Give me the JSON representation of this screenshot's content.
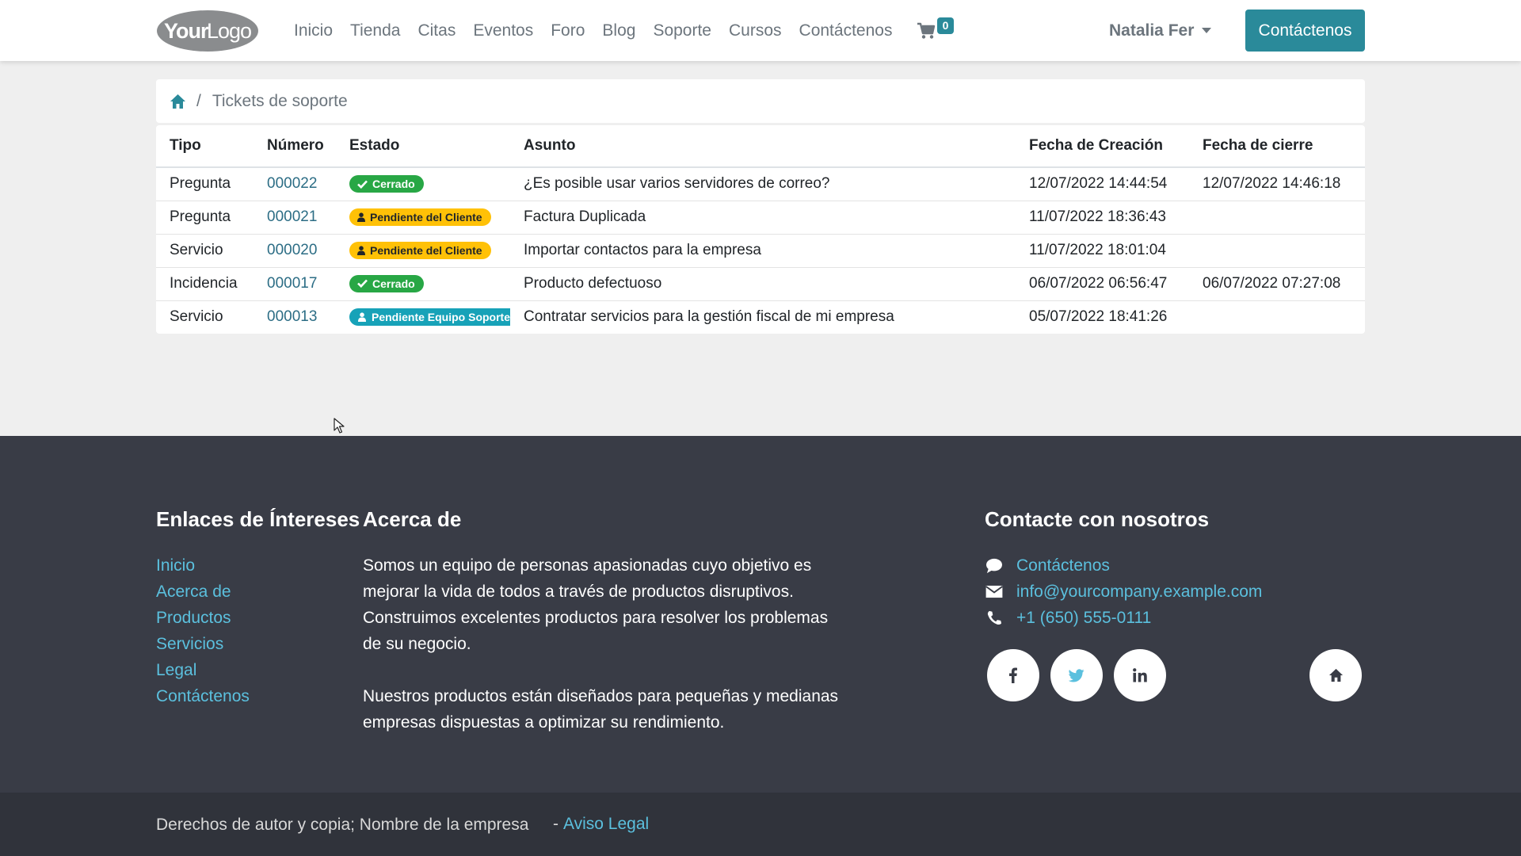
{
  "header": {
    "logo_text": "YourLogo",
    "nav": [
      "Inicio",
      "Tienda",
      "Citas",
      "Eventos",
      "Foro",
      "Blog",
      "Soporte",
      "Cursos",
      "Contáctenos"
    ],
    "cart_count": "0",
    "user_name": "Natalia Fer",
    "contact_button": "Contáctenos"
  },
  "breadcrumb": {
    "separator": "/",
    "current": "Tickets de soporte"
  },
  "table": {
    "headers": {
      "tipo": "Tipo",
      "numero": "Número",
      "estado": "Estado",
      "asunto": "Asunto",
      "fecha_creacion": "Fecha de Creación",
      "fecha_cierre": "Fecha de cierre"
    },
    "rows": [
      {
        "tipo": "Pregunta",
        "numero": "000022",
        "estado": "Cerrado",
        "estado_kind": "success",
        "asunto": "¿Es posible usar varios servidores de correo?",
        "fecha_creacion": "12/07/2022 14:44:54",
        "fecha_cierre": "12/07/2022 14:46:18"
      },
      {
        "tipo": "Pregunta",
        "numero": "000021",
        "estado": "Pendiente del Cliente",
        "estado_kind": "warning",
        "asunto": "Factura Duplicada",
        "fecha_creacion": "11/07/2022 18:36:43",
        "fecha_cierre": ""
      },
      {
        "tipo": "Servicio",
        "numero": "000020",
        "estado": "Pendiente del Cliente",
        "estado_kind": "warning",
        "asunto": "Importar contactos para la empresa",
        "fecha_creacion": "11/07/2022 18:01:04",
        "fecha_cierre": ""
      },
      {
        "tipo": "Incidencia",
        "numero": "000017",
        "estado": "Cerrado",
        "estado_kind": "success",
        "asunto": "Producto defectuoso",
        "fecha_creacion": "06/07/2022 06:56:47",
        "fecha_cierre": "06/07/2022 07:27:08"
      },
      {
        "tipo": "Servicio",
        "numero": "000013",
        "estado": "Pendiente Equipo Soporte",
        "estado_kind": "info",
        "asunto": "Contratar servicios para la gestión fiscal de mi empresa",
        "fecha_creacion": "05/07/2022 18:41:26",
        "fecha_cierre": ""
      }
    ]
  },
  "footer": {
    "links_title": "Enlaces de Íntereses",
    "links": [
      "Inicio",
      "Acerca de",
      "Productos",
      "Servicios",
      "Legal",
      "Contáctenos"
    ],
    "about_title": "Acerca de",
    "about_p1": "Somos un equipo de personas apasionadas cuyo objetivo es mejorar la vida de todos a través de productos disruptivos. Construimos excelentes productos para resolver los problemas de su negocio.",
    "about_p2": "Nuestros productos están diseñados para pequeñas y medianas empresas dispuestas a optimizar su rendimiento.",
    "contact_title": "Contacte con nosotros",
    "contact_link": "Contáctenos",
    "email": "info@yourcompany.example.com",
    "phone": "+1 (650) 555-0111",
    "social": [
      "facebook-icon",
      "twitter-icon",
      "linkedin-icon",
      "home-icon"
    ],
    "copyright": "Derechos de autor y copia; Nombre de la empresa",
    "copyright_dash": "-",
    "legal_link": "Aviso Legal"
  },
  "colors": {
    "primary": "#2a8a9a",
    "link": "#5bc0de",
    "footer_bg": "#393c46",
    "copyright_bg": "#30333b",
    "badge_success": "#28a745",
    "badge_warning": "#ffc107",
    "badge_info": "#17a2b8"
  }
}
